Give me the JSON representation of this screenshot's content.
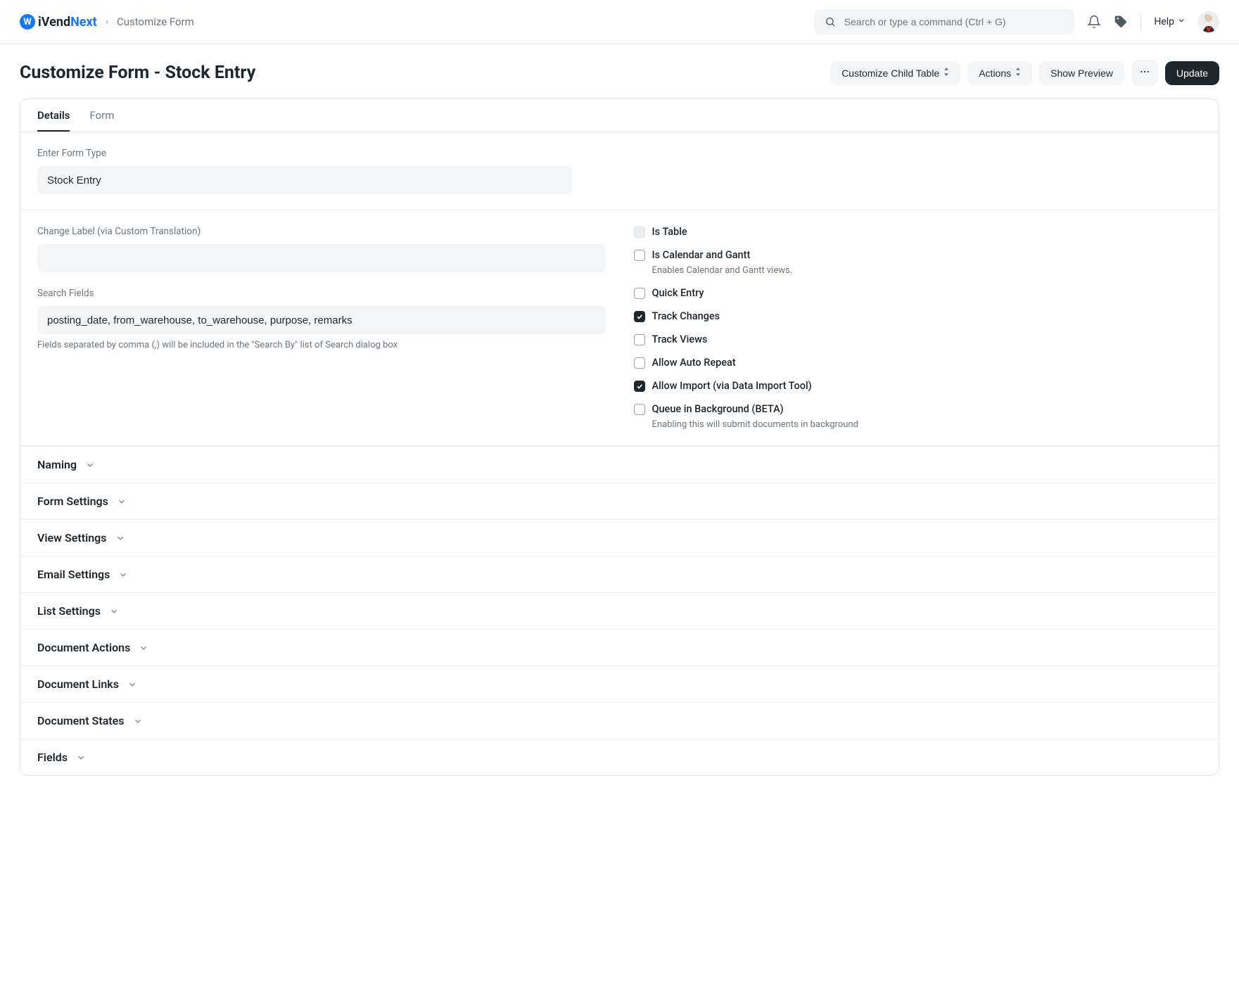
{
  "nav": {
    "logo_text_a": "iVend",
    "logo_text_b": "Next",
    "breadcrumb": "Customize Form",
    "search_placeholder": "Search or type a command (Ctrl + G)",
    "help_label": "Help"
  },
  "page": {
    "title": "Customize Form - Stock Entry",
    "btn_customize_child": "Customize Child Table",
    "btn_actions": "Actions",
    "btn_show_preview": "Show Preview",
    "btn_update": "Update"
  },
  "tabs": {
    "details": "Details",
    "form": "Form"
  },
  "details": {
    "form_type_label": "Enter Form Type",
    "form_type_value": "Stock Entry",
    "change_label_label": "Change Label (via Custom Translation)",
    "change_label_value": "",
    "search_fields_label": "Search Fields",
    "search_fields_value": "posting_date, from_warehouse, to_warehouse, purpose, remarks",
    "search_fields_help": "Fields separated by comma (,) will be included in the \"Search By\" list of Search dialog box"
  },
  "checks": {
    "is_table": "Is Table",
    "is_calendar": "Is Calendar and Gantt",
    "is_calendar_help": "Enables Calendar and Gantt views.",
    "quick_entry": "Quick Entry",
    "track_changes": "Track Changes",
    "track_views": "Track Views",
    "auto_repeat": "Allow Auto Repeat",
    "allow_import": "Allow Import (via Data Import Tool)",
    "queue_bg": "Queue in Background (BETA)",
    "queue_bg_help": "Enabling this will submit documents in background"
  },
  "sections": {
    "naming": "Naming",
    "form_settings": "Form Settings",
    "view_settings": "View Settings",
    "email_settings": "Email Settings",
    "list_settings": "List Settings",
    "document_actions": "Document Actions",
    "document_links": "Document Links",
    "document_states": "Document States",
    "fields": "Fields"
  }
}
